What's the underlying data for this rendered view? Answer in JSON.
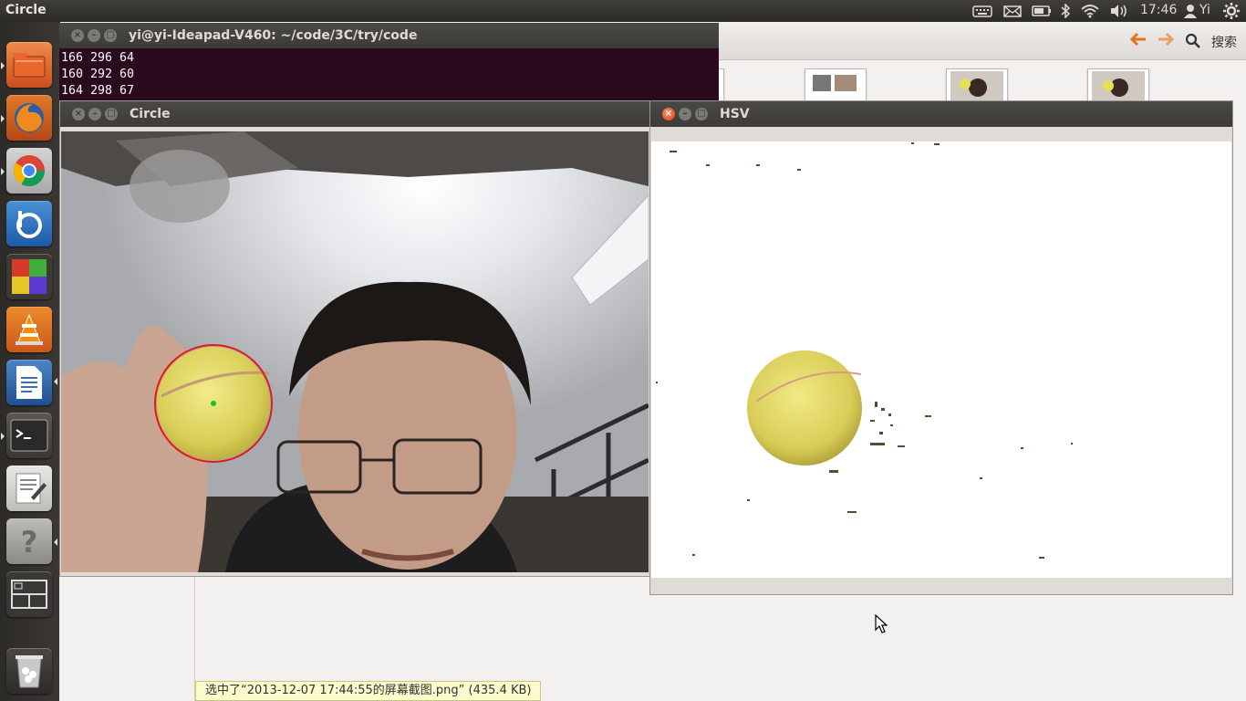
{
  "top_panel": {
    "app_title": "Circle",
    "clock": "17:46",
    "user": "Yi",
    "icons": [
      "keyboard-icon",
      "mail-icon",
      "battery-icon",
      "bluetooth-icon",
      "wifi-icon",
      "volume-icon",
      "user-icon",
      "gear-icon"
    ]
  },
  "launcher": {
    "items": [
      "files",
      "firefox",
      "chrome",
      "bluefish",
      "cube-app",
      "vlc",
      "writer",
      "terminal",
      "text-editor",
      "help",
      "workspace-switcher",
      "trash"
    ]
  },
  "file_manager": {
    "search_label": "搜索",
    "status_selection": "选中了“2013-12-07 17:44:55的屏幕截图.png” (435.4 KB)"
  },
  "terminal": {
    "title": "yi@yi-Ideapad-V460: ~/code/3C/try/code",
    "lines": [
      "166 296 64",
      "160 292 60",
      "164 298 67"
    ]
  },
  "circle_window": {
    "title": "Circle"
  },
  "hsv_window": {
    "title": "HSV"
  },
  "colors": {
    "panel": "#3c3b37",
    "terminal_bg": "#2c0a1e",
    "close_active": "#e0481a",
    "circle_marker": "#e21a1a",
    "center_marker": "#20c020",
    "arrow_orange": "#e8711f"
  }
}
